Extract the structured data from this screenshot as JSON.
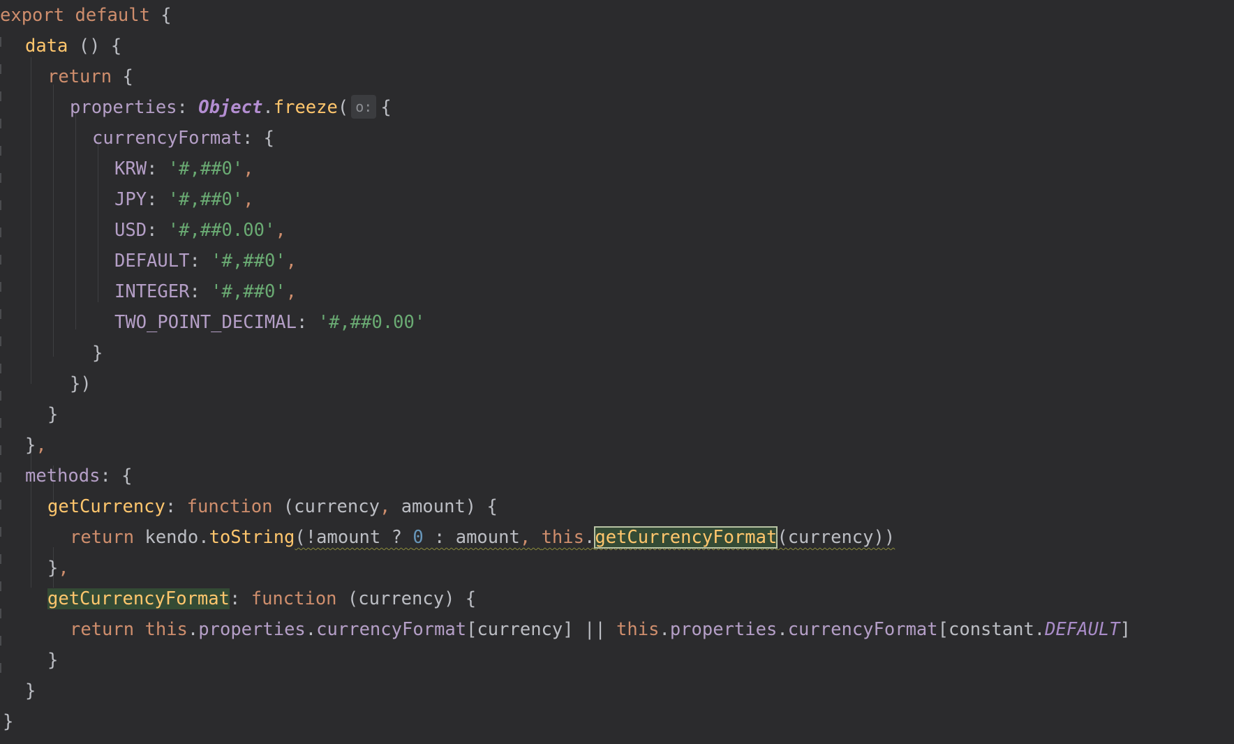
{
  "editor": {
    "language": "javascript",
    "lines": [
      [
        "export",
        " default ",
        "{"
      ],
      [
        "data",
        " () {"
      ],
      [
        "return",
        " {"
      ],
      [
        "properties",
        ": ",
        "Object",
        ".",
        "freeze",
        "(",
        "o:",
        "{"
      ],
      [
        "currencyFormat",
        ": {"
      ],
      [
        "KRW",
        ": ",
        "'#,##0'",
        ","
      ],
      [
        "JPY",
        ": ",
        "'#,##0'",
        ","
      ],
      [
        "USD",
        ": ",
        "'#,##0.00'",
        ","
      ],
      [
        "DEFAULT",
        ": ",
        "'#,##0'",
        ","
      ],
      [
        "INTEGER",
        ": ",
        "'#,##0'",
        ","
      ],
      [
        "TWO_POINT_DECIMAL",
        ": ",
        "'#,##0.00'"
      ],
      [
        "}"
      ],
      [
        "})"
      ],
      [
        "}"
      ],
      [
        "}",
        ","
      ],
      [
        "methods",
        ": {"
      ],
      [
        "getCurrency",
        ": ",
        "function",
        " (currency",
        ", ",
        "amount) {"
      ],
      [
        "return",
        " kendo.",
        "toString",
        "(!amount ? ",
        "0",
        " : amount",
        ", ",
        "this",
        ".",
        "getCurrencyFormat",
        "(currency))"
      ],
      [
        "}",
        ","
      ],
      [
        "getCurrencyFormat",
        ": ",
        "function",
        " (currency) {"
      ],
      [
        "return",
        " ",
        "this",
        ".",
        "properties",
        ".",
        "currencyFormat",
        "[currency] || ",
        "this",
        ".",
        "properties",
        ".",
        "currencyFormat",
        "[constant.",
        "DEFAULT",
        "]"
      ],
      [
        "}"
      ],
      [
        "}"
      ],
      [
        "}"
      ]
    ],
    "colors": {
      "background": "#2b2b2d",
      "keyword": "#cf8e6d",
      "property": "#b59fc7",
      "string": "#6aab73",
      "function": "#ffc66d",
      "number": "#6897bb",
      "text": "#bcbec4",
      "highlight": "#344b35"
    }
  }
}
